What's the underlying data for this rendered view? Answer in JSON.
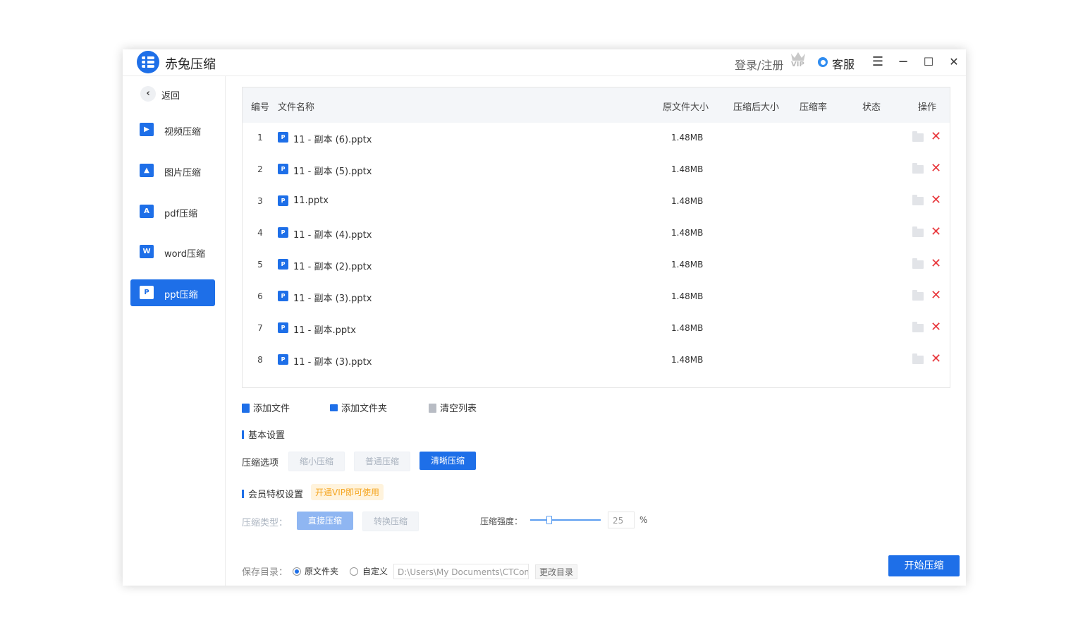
{
  "app": {
    "title": "赤兔压缩"
  },
  "header": {
    "login": "登录/注册",
    "vip_badge": "VIP",
    "support": "客服",
    "menu_icon": "☰",
    "minimize_icon": "−",
    "maximize_icon": "☐",
    "close_icon": "✕"
  },
  "sidebar": {
    "back": "返回",
    "items": [
      {
        "label": "视频压缩",
        "icon": "video-icon",
        "glyph": "▶",
        "active": false
      },
      {
        "label": "图片压缩",
        "icon": "image-icon",
        "glyph": "▲",
        "active": false
      },
      {
        "label": "pdf压缩",
        "icon": "pdf-icon",
        "glyph": "A",
        "active": false
      },
      {
        "label": "word压缩",
        "icon": "word-icon",
        "glyph": "W",
        "active": false
      },
      {
        "label": "ppt压缩",
        "icon": "ppt-icon",
        "glyph": "P",
        "active": true
      }
    ]
  },
  "table": {
    "headers": {
      "num": "编号",
      "name": "文件名称",
      "orig_size": "原文件大小",
      "comp_size": "压缩后大小",
      "ratio": "压缩率",
      "status": "状态",
      "action": "操作"
    },
    "rows": [
      {
        "num": "1",
        "name": "11 - 副本 (6).pptx",
        "size": "1.48MB"
      },
      {
        "num": "2",
        "name": "11 - 副本 (5).pptx",
        "size": "1.48MB"
      },
      {
        "num": "3",
        "name": "11.pptx",
        "size": "1.48MB"
      },
      {
        "num": "4",
        "name": "11 - 副本 (4).pptx",
        "size": "1.48MB"
      },
      {
        "num": "5",
        "name": "11 - 副本 (2).pptx",
        "size": "1.48MB"
      },
      {
        "num": "6",
        "name": "11 - 副本 (3).pptx",
        "size": "1.48MB"
      },
      {
        "num": "7",
        "name": "11 - 副本.pptx",
        "size": "1.48MB"
      },
      {
        "num": "8",
        "name": "11 - 副本 (3).pptx",
        "size": "1.48MB"
      }
    ]
  },
  "toolbar": {
    "add_file": "添加文件",
    "add_folder": "添加文件夹",
    "clear_list": "清空列表"
  },
  "settings": {
    "basic_title": "基本设置",
    "option_label": "压缩选项",
    "options": [
      "缩小压缩",
      "普通压缩",
      "清晰压缩"
    ],
    "selected_option": "清晰压缩"
  },
  "vip": {
    "title": "会员特权设置",
    "tag": "开通VIP即可使用",
    "type_label": "压缩类型：",
    "types": [
      "直接压缩",
      "转换压缩"
    ],
    "strength_label": "压缩强度：",
    "strength_value": "25",
    "strength_unit": "%"
  },
  "save": {
    "label": "保存目录：",
    "original": "原文件夹",
    "custom": "自定义",
    "path": "D:\\Users\\My Documents\\CTCompr",
    "change": "更改目录",
    "selected": "原文件夹"
  },
  "start_button": "开始压缩",
  "colors": {
    "accent": "#1e6fe8",
    "danger": "#e8383d",
    "vip": "#f5a623"
  }
}
